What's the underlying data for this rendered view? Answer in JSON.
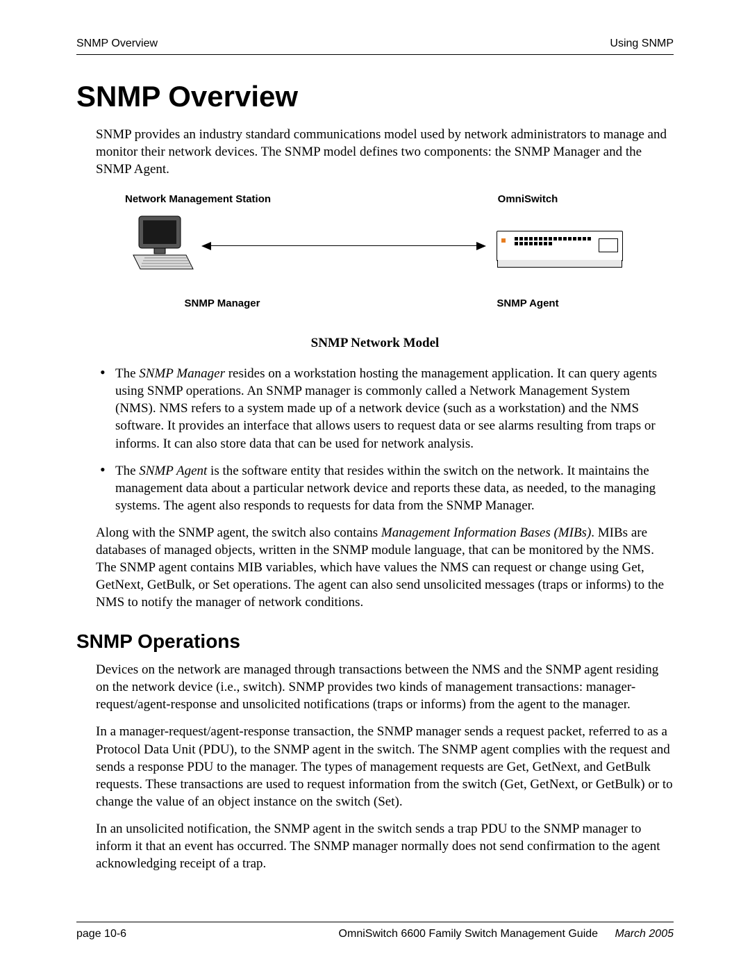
{
  "header": {
    "left": "SNMP Overview",
    "right": "Using SNMP"
  },
  "title": "SNMP Overview",
  "intro_paragraph": "SNMP provides an industry standard communications model used by network administrators to manage and monitor their network devices. The SNMP model defines two components: the SNMP Manager and the SNMP Agent.",
  "diagram": {
    "top_left": "Network Management Station",
    "top_right": "OmniSwitch",
    "bottom_left": "SNMP Manager",
    "bottom_right": "SNMP Agent",
    "caption": "SNMP Network Model"
  },
  "bullets": [
    {
      "prefix": "The ",
      "em": "SNMP Manager",
      "rest": " resides on a workstation hosting the management application. It can query agents using SNMP operations. An SNMP manager is commonly called a Network Management System (NMS). NMS refers to a system made up of a network device (such as a workstation) and the NMS software. It provides an interface that allows users to request data or see alarms resulting from traps or informs. It can also store data that can be used for network analysis."
    },
    {
      "prefix": "The ",
      "em": "SNMP Agent",
      "rest": " is the software entity that resides within the switch on the network. It maintains the management data about a particular network device and reports these data, as needed, to the managing systems. The agent also responds to requests for data from the SNMP Manager."
    }
  ],
  "mib_para": {
    "pre": "Along with the SNMP agent, the switch also contains ",
    "em": "Management Information Bases (MIBs)",
    "post": ". MIBs are databases of managed objects, written in the SNMP module language, that can be monitored by the NMS. The SNMP agent contains MIB variables, which have values the NMS can request or change using Get, GetNext, GetBulk, or Set operations. The agent can also send unsolicited messages (traps or informs) to the NMS to notify the manager of network conditions."
  },
  "subheading": "SNMP Operations",
  "ops_paragraphs": [
    "Devices on the network are managed through transactions between the NMS and the SNMP agent residing on the network device (i.e., switch). SNMP provides two kinds of management transactions: manager-request/agent-response and unsolicited notifications (traps or informs) from the agent to the manager.",
    "In a manager-request/agent-response transaction, the SNMP manager sends a request packet, referred to as a Protocol Data Unit (PDU), to the SNMP agent in the switch. The SNMP agent complies with the request and sends a response PDU to the manager. The types of management requests are Get, GetNext, and GetBulk requests. These transactions are used to request information from the switch (Get, GetNext, or GetBulk) or to change the value of an object instance on the switch (Set).",
    "In an unsolicited notification, the SNMP agent in the switch sends a trap PDU to the SNMP manager to inform it that an event has occurred. The SNMP manager normally does not send confirmation to the agent acknowledging receipt of a trap."
  ],
  "footer": {
    "left": "page 10-6",
    "center": "OmniSwitch 6600 Family Switch Management Guide",
    "date": "March 2005"
  }
}
